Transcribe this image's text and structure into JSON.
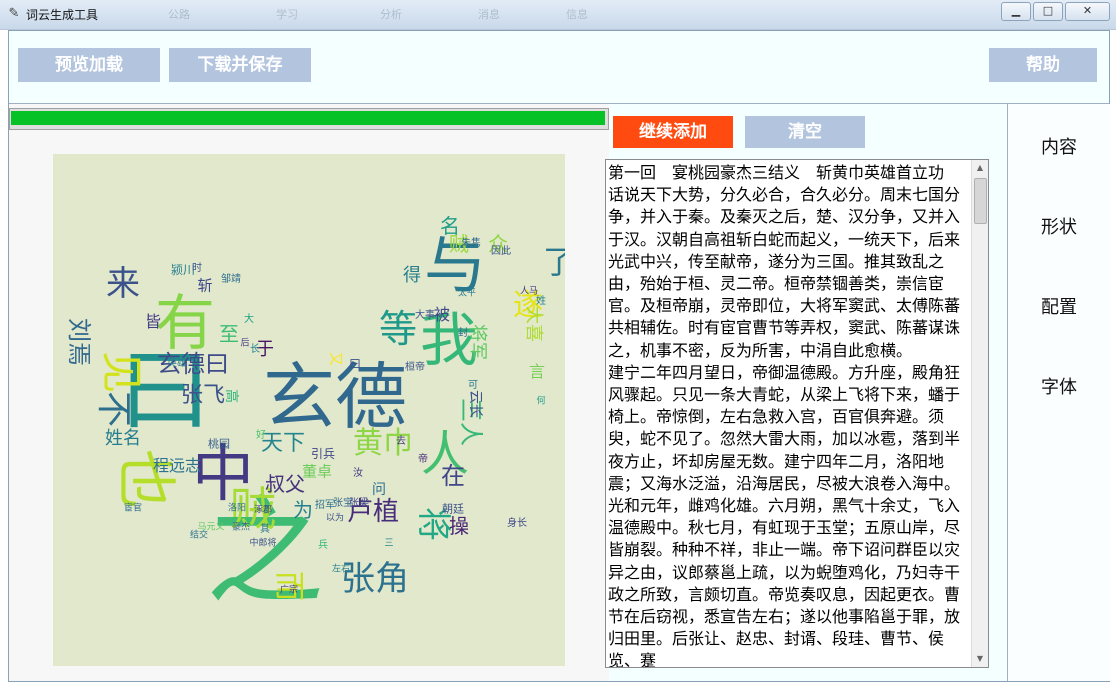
{
  "window": {
    "title": "词云生成工具",
    "ghost_items": [
      "公路",
      "学习",
      "分析",
      "消息",
      "信息"
    ],
    "controls": {
      "minimize": "▁",
      "maximize": "□",
      "close": "✕"
    }
  },
  "toolbar": {
    "preview_label": "预览加载",
    "download_label": "下载并保存",
    "help_label": "帮助"
  },
  "progress": {
    "value": 1.0,
    "color": "#06c226"
  },
  "content_panel": {
    "continue_add_label": "继续添加",
    "clear_label": "清空",
    "text": "第一回　宴桃园豪杰三结义　斩黄巾英雄首立功\n话说天下大势，分久必合，合久必分。周末七国分争，并入于秦。及秦灭之后，楚、汉分争，又并入于汉。汉朝自高祖斩白蛇而起义，一统天下，后来光武中兴，传至献帝，遂分为三国。推其致乱之由，殆始于桓、灵二帝。桓帝禁锢善类，崇信宦官。及桓帝崩，灵帝即位，大将军窦武、太傅陈蕃共相辅佐。时有宦官曹节等弄权，窦武、陈蕃谋诛之，机事不密，反为所害，中涓自此愈横。\n建宁二年四月望日，帝御温德殿。方升座，殿角狂风骤起。只见一条大青蛇，从梁上飞将下来，蟠于椅上。帝惊倒，左右急救入宫，百官俱奔避。须臾，蛇不见了。忽然大雷大雨，加以冰雹，落到半夜方止，坏却房屋无数。建宁四年二月，洛阳地震；又海水泛溢，沿海居民，尽被大浪卷入海中。光和元年，雌鸡化雄。六月朔，黑气十余丈，飞入温德殿中。秋七月，有虹现于玉堂；五原山岸，尽皆崩裂。种种不祥，非止一端。帝下诏问群臣以灾异之由，议郎蔡邕上疏，以为蜺堕鸡化，乃妇寺干政之所致，言颇切直。帝览奏叹息，因起更衣。曹节在后窃视，悉宣告左右；遂以他事陷邕于罪，放归田里。后张让、赵忠、封谞、段珪、曹节、侯览、蹇"
  },
  "side_tabs": [
    "内容",
    "形状",
    "配置",
    "字体"
  ],
  "colors": {
    "continue_btn": "#ff4a10",
    "muted_btn": "#b3c4de",
    "wordcloud_bg": "#e2e8cc"
  },
  "wordcloud": {
    "words": [
      {
        "t": "曰",
        "c": "#21918c"
      },
      {
        "t": "之",
        "c": "#3fbc73"
      },
      {
        "t": "玄德",
        "c": "#31688e"
      },
      {
        "t": "有",
        "c": "#86d549"
      },
      {
        "t": "中",
        "c": "#443983"
      },
      {
        "t": "也",
        "c": "#b5de2b"
      },
      {
        "t": "我",
        "c": "#35b779"
      },
      {
        "t": "与",
        "c": "#2a788e"
      },
      {
        "t": "贼",
        "c": "#a5db36"
      },
      {
        "t": "人",
        "c": "#44bf70"
      },
      {
        "t": "张角",
        "c": "#2c728e"
      },
      {
        "t": "来",
        "c": "#3b528b"
      },
      {
        "t": "见",
        "c": "#d2e21b"
      },
      {
        "t": "不",
        "c": "#2e6f8e"
      },
      {
        "t": "黄巾",
        "c": "#8ed645"
      },
      {
        "t": "等",
        "c": "#1f9a8a"
      },
      {
        "t": "遂",
        "c": "#e5e419"
      },
      {
        "t": "将",
        "c": "#22a884"
      },
      {
        "t": "卢植",
        "c": "#472d7b"
      },
      {
        "t": "而",
        "c": "#c8e020"
      },
      {
        "t": "了",
        "c": "#2a788e"
      },
      {
        "t": "张飞",
        "c": "#3b528b"
      },
      {
        "t": "玄德曰",
        "c": "#3e4a89"
      },
      {
        "t": "刘焉",
        "c": "#31688e"
      },
      {
        "t": "天下",
        "c": "#25858e"
      },
      {
        "t": "叔父",
        "c": "#46327e"
      },
      {
        "t": "在",
        "c": "#404688"
      },
      {
        "t": "姓名",
        "c": "#287d8e"
      },
      {
        "t": "至",
        "c": "#3dbc74"
      },
      {
        "t": "为",
        "c": "#26818e"
      },
      {
        "t": "操",
        "c": "#482475"
      },
      {
        "t": "三人",
        "c": "#37b878"
      },
      {
        "t": "贼",
        "c": "#9bd93c"
      },
      {
        "t": "众",
        "c": "#90d743"
      },
      {
        "t": "名",
        "c": "#1f9e89"
      },
      {
        "t": "言",
        "c": "#75d054"
      },
      {
        "t": "得",
        "c": "#277f8e"
      },
      {
        "t": "程远志",
        "c": "#2c728e"
      },
      {
        "t": "董卓",
        "c": "#6ccd5a"
      },
      {
        "t": "于",
        "c": "#471365"
      },
      {
        "t": "皆",
        "c": "#433e85"
      },
      {
        "t": "被",
        "c": "#3f4889"
      },
      {
        "t": "问",
        "c": "#2d708e"
      },
      {
        "t": "云长",
        "c": "#3b528b"
      },
      {
        "t": "将军",
        "c": "#5ec962"
      },
      {
        "t": "大喜",
        "c": "#addc30"
      },
      {
        "t": "斩",
        "c": "#3e4989"
      },
      {
        "t": "高",
        "c": "#2fb47c"
      },
      {
        "t": "颍川",
        "c": "#277f8e"
      },
      {
        "t": "又",
        "c": "#f8e621"
      },
      {
        "t": "曰",
        "c": "#3b528b"
      },
      {
        "t": "桃园",
        "c": "#35608d"
      },
      {
        "t": "英雄",
        "c": "#297a8e"
      },
      {
        "t": "时",
        "c": "#3b528b"
      },
      {
        "t": "邹靖",
        "c": "#2e6e8e"
      },
      {
        "t": "大",
        "c": "#1fa187"
      },
      {
        "t": "长",
        "c": "#26828e"
      },
      {
        "t": "汝",
        "c": "#453781"
      },
      {
        "t": "引兵",
        "c": "#404588"
      },
      {
        "t": "朝廷",
        "c": "#3b528b"
      },
      {
        "t": "好",
        "c": "#4ac16d"
      },
      {
        "t": "其",
        "c": "#2a788e"
      },
      {
        "t": "立功",
        "c": "#3b528b"
      },
      {
        "t": "三",
        "c": "#24868e"
      },
      {
        "t": "太平",
        "c": "#2a788e"
      },
      {
        "t": "封",
        "c": "#31688e"
      },
      {
        "t": "去",
        "c": "#443983"
      },
      {
        "t": "朱隽",
        "c": "#31688e"
      },
      {
        "t": "因此",
        "c": "#3b528b"
      },
      {
        "t": "姓",
        "c": "#26818e"
      },
      {
        "t": "招军",
        "c": "#2c728e"
      },
      {
        "t": "身长",
        "c": "#3e4989"
      },
      {
        "t": "广宗",
        "c": "#443983"
      },
      {
        "t": "中郎将",
        "c": "#3b528b"
      },
      {
        "t": "结交",
        "c": "#2c728e"
      },
      {
        "t": "马元义",
        "c": "#5ec962"
      },
      {
        "t": "豪杰",
        "c": "#31688e"
      },
      {
        "t": "左右",
        "c": "#277f8e"
      },
      {
        "t": "后",
        "c": "#443983"
      },
      {
        "t": "宦官",
        "c": "#2e6e8e"
      },
      {
        "t": "涿郡",
        "c": "#3e4989"
      },
      {
        "t": "洛阳",
        "c": "#2d708e"
      },
      {
        "t": "桓帝",
        "c": "#3b528b"
      },
      {
        "t": "帝",
        "c": "#472d7b"
      },
      {
        "t": "兵",
        "c": "#35b779"
      },
      {
        "t": "可",
        "c": "#2a788e"
      },
      {
        "t": "以为",
        "c": "#3b528b"
      },
      {
        "t": "张宝",
        "c": "#31688e"
      },
      {
        "t": "张梁",
        "c": "#3e4989"
      },
      {
        "t": "何",
        "c": "#1f9e89"
      },
      {
        "t": "大事",
        "c": "#3b528b"
      },
      {
        "t": "人马",
        "c": "#443983"
      }
    ]
  }
}
